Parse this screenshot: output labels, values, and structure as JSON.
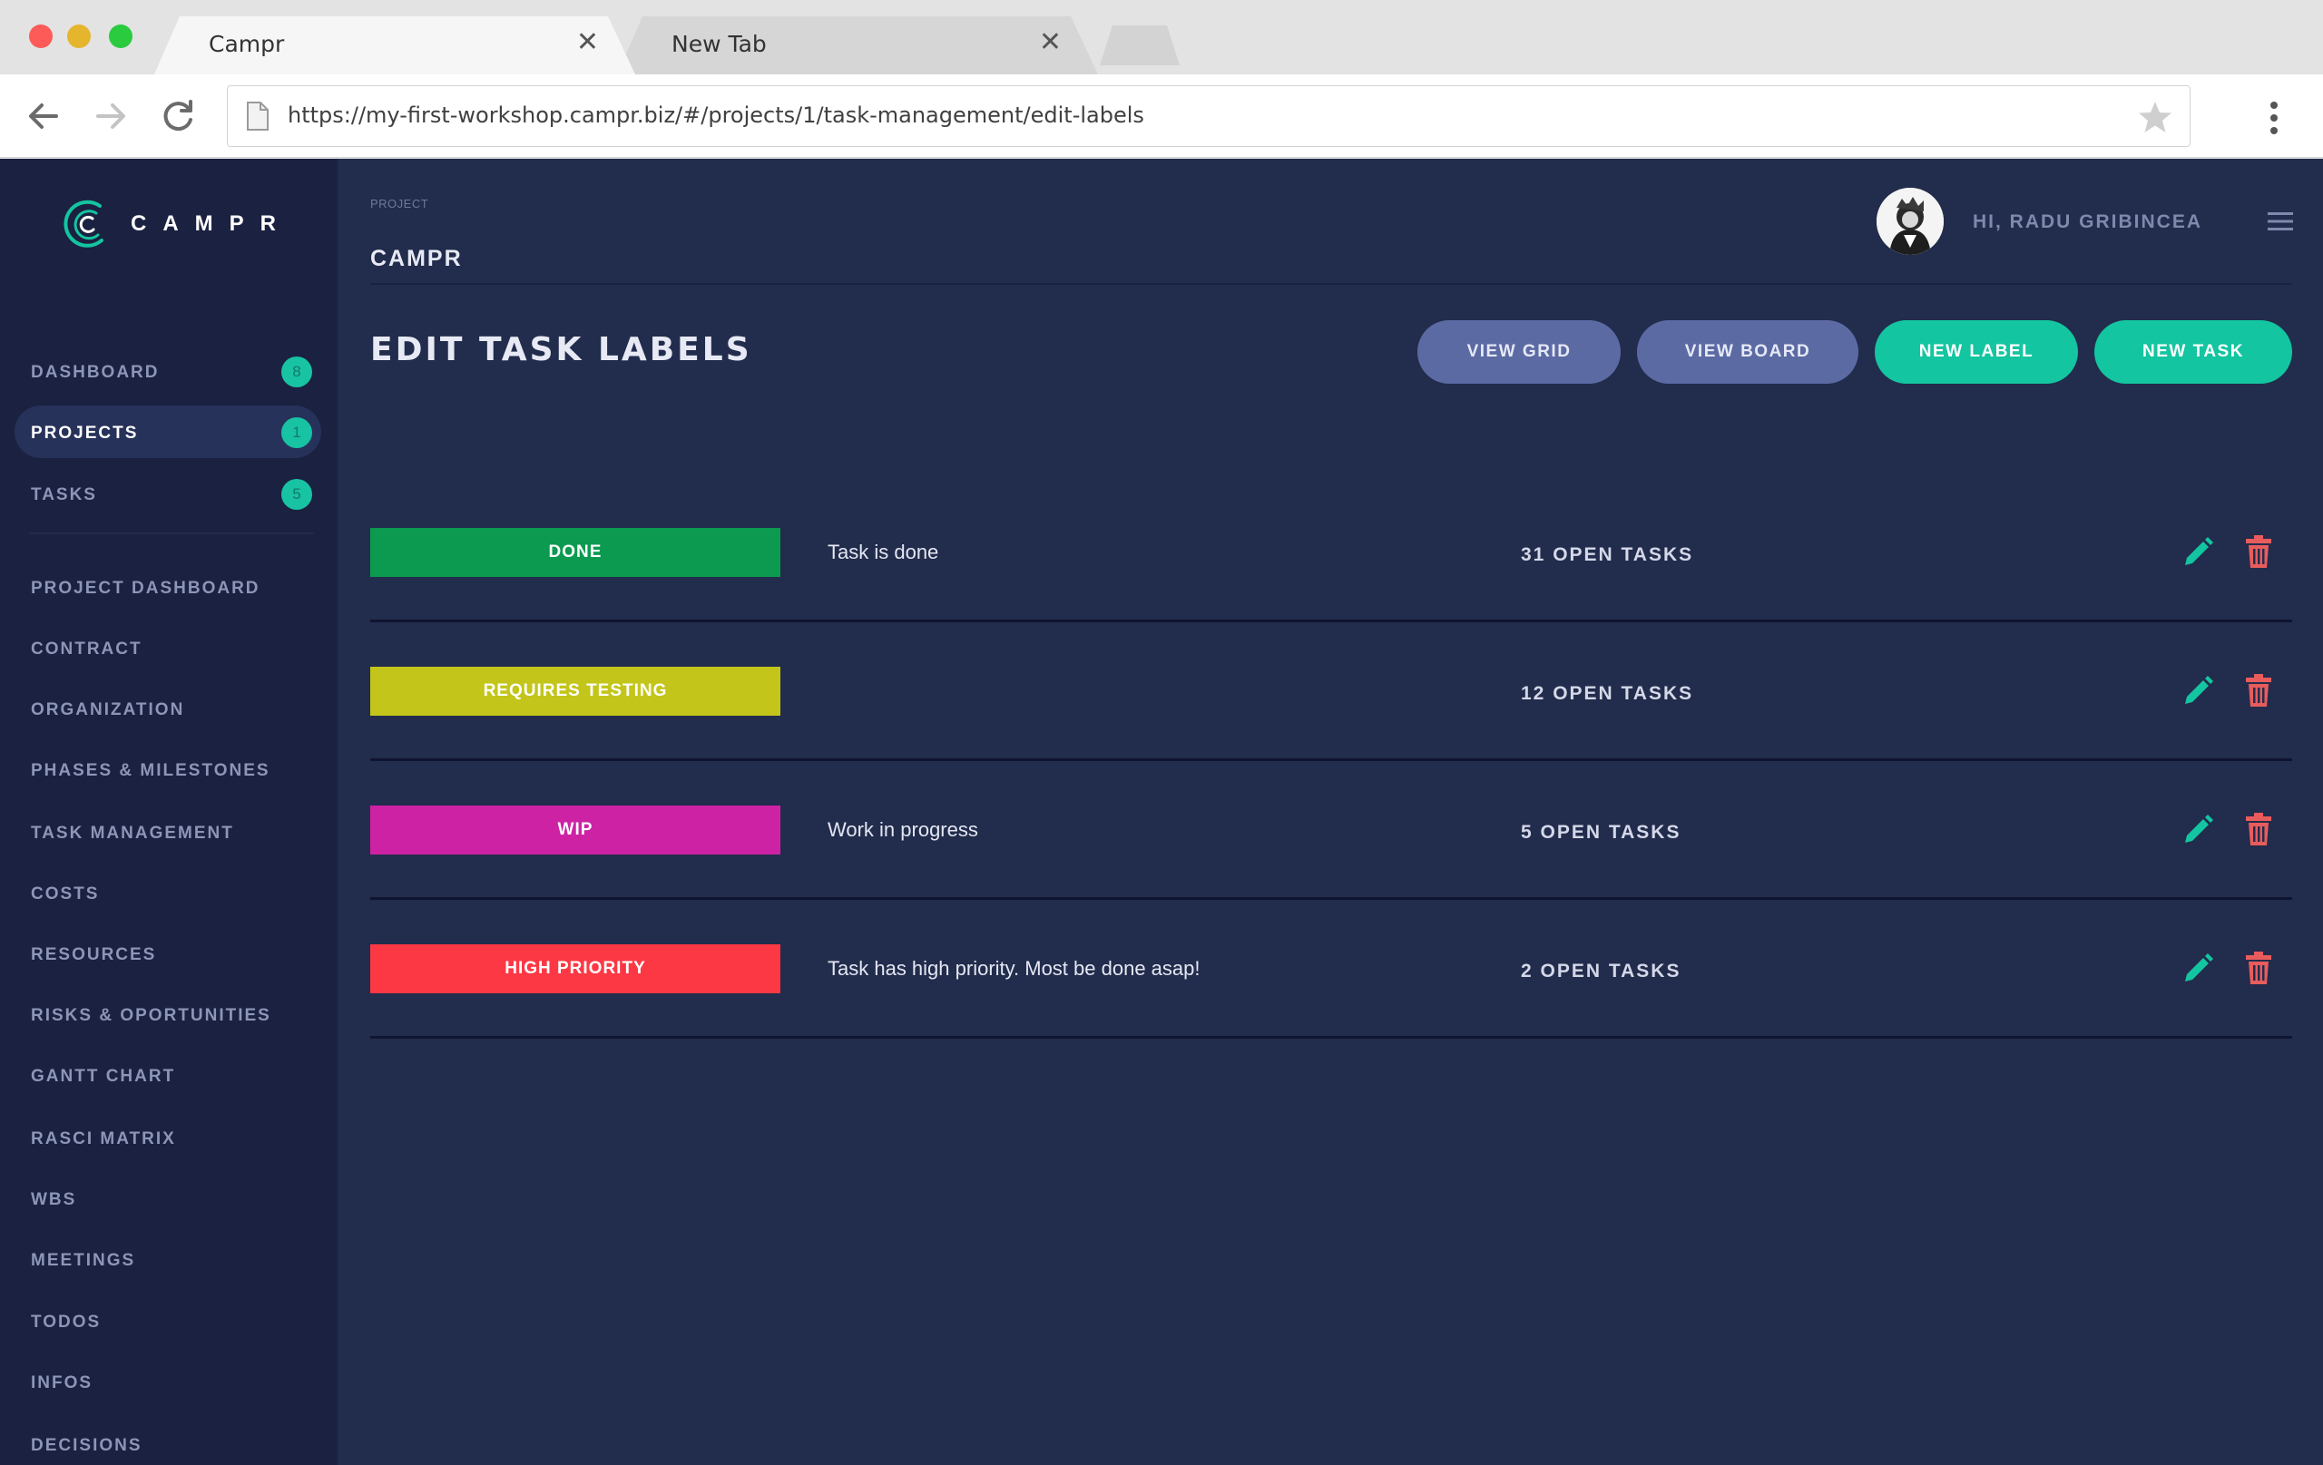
{
  "browser": {
    "tabs": [
      {
        "title": "Campr"
      },
      {
        "title": "New Tab"
      }
    ],
    "url": "https://my-first-workshop.campr.biz/#/projects/1/task-management/edit-labels"
  },
  "app": {
    "logo_text": "CAMPR",
    "nav_main": [
      {
        "label": "DASHBOARD",
        "badge": "8",
        "active": false
      },
      {
        "label": "PROJECTS",
        "badge": "1",
        "active": true
      },
      {
        "label": "TASKS",
        "badge": "5",
        "active": false
      }
    ],
    "nav_project": [
      "PROJECT DASHBOARD",
      "CONTRACT",
      "ORGANIZATION",
      "PHASES & MILESTONES",
      "TASK MANAGEMENT",
      "COSTS",
      "RESOURCES",
      "RISKS & OPORTUNITIES",
      "GANTT CHART",
      "RASCI MATRIX",
      "WBS",
      "MEETINGS",
      "TODOS",
      "INFOS",
      "DECISIONS"
    ]
  },
  "header": {
    "crumb_small": "PROJECT",
    "project_name": "CAMPR",
    "greeting": "HI, RADU GRIBINCEA"
  },
  "page": {
    "title": "EDIT TASK LABELS",
    "buttons": {
      "view_grid": "VIEW GRID",
      "view_board": "VIEW BOARD",
      "new_label": "NEW LABEL",
      "new_task": "NEW TASK"
    },
    "labels": [
      {
        "name": "DONE",
        "color": "#0b9a4f",
        "description": "Task is done",
        "open_tasks": "31 OPEN TASKS"
      },
      {
        "name": "REQUIRES TESTING",
        "color": "#c3c51a",
        "description": "",
        "open_tasks": "12 OPEN TASKS"
      },
      {
        "name": "WIP",
        "color": "#ce22a5",
        "description": "Work in progress",
        "open_tasks": "5 OPEN TASKS"
      },
      {
        "name": "HIGH PRIORITY",
        "color": "#fc3844",
        "description": "Task has high priority. Most be done asap!",
        "open_tasks": "2 OPEN TASKS"
      }
    ]
  },
  "colors": {
    "accent": "#13c5a0",
    "secondary_button": "#5c6aa4",
    "delete": "#e85c5c",
    "background": "#222c4c",
    "sidebar": "#1b2140"
  }
}
